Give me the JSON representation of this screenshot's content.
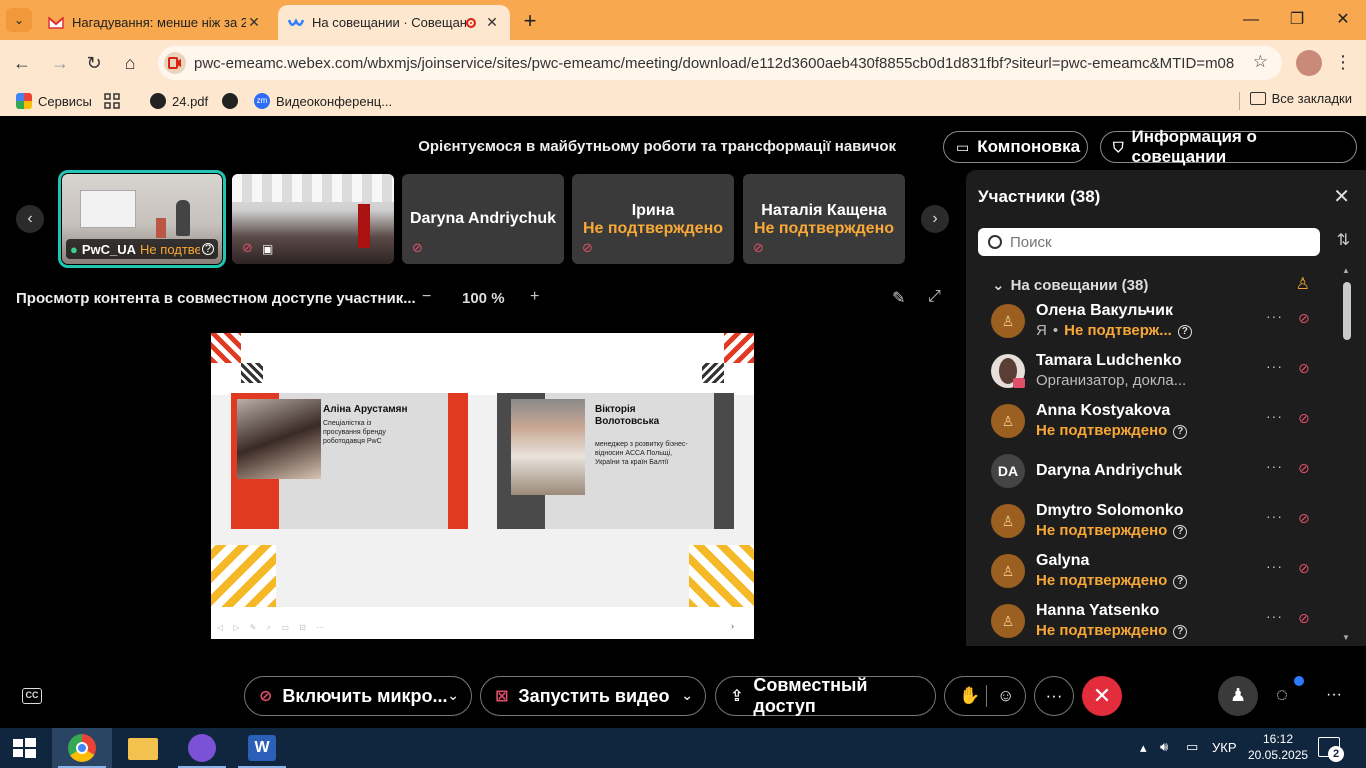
{
  "browser": {
    "tabs": [
      {
        "title": "Нагадування: менше ніж за 2 ...",
        "active": false
      },
      {
        "title": "На совещании · Совещани...",
        "active": true
      }
    ],
    "url": "pwc-emeamc.webex.com/wbxmjs/joinservice/sites/pwc-emeamc/meeting/download/e112d3600aeb430f8855cb0d1d831fbf?siteurl=pwc-emeamc&MTID=m08361b51c...",
    "bookmarks": [
      {
        "label": "Сервисы"
      },
      {
        "label": "24.pdf"
      },
      {
        "label": ""
      },
      {
        "label": "Видеоконференц..."
      }
    ],
    "all_bookmarks": "Все закладки"
  },
  "meeting": {
    "title": "Орієнтуємося в майбутньому роботи та трансформації навичок",
    "layout_button": "Компоновка",
    "info_button": "Информация о совещании",
    "content_label": "Просмотр контента в совместном доступе участник...",
    "zoom_level": "100 %",
    "tiles": [
      {
        "name": "PwC_UA",
        "status": "Не подтверждено"
      },
      {
        "name": "",
        "status": ""
      },
      {
        "name": "Daryna Andriychuk",
        "status": ""
      },
      {
        "name": "Ірина",
        "status": "Не подтверждено"
      },
      {
        "name": "Наталія Кащена",
        "status": "Не подтверждено"
      }
    ]
  },
  "slide": {
    "person1": {
      "name": "Аліна Арустамян",
      "role": "Спеціалістка із просування бренду роботодавця PwC"
    },
    "person2": {
      "name": "Вікторія Волотовська",
      "role": "менеджер з розвитку бізнес-відносин ACCA Польщі, України та країн Балтії"
    },
    "page": "›"
  },
  "participants": {
    "title": "Участники (38)",
    "search_placeholder": "Поиск",
    "group": "На совещании (38)",
    "list": [
      {
        "name": "Олена Вакульчик",
        "me": "Я",
        "status": "Не подтверж...",
        "avatar": "default"
      },
      {
        "name": "Tamara Ludchenko",
        "role": "Организатор, докла...",
        "avatar": "photo"
      },
      {
        "name": "Anna Kostyakova",
        "status": "Не подтверждено",
        "avatar": "default"
      },
      {
        "name": "Daryna Andriychuk",
        "avatar": "initials",
        "initials": "DA"
      },
      {
        "name": "Dmytro Solomonko",
        "status": "Не подтверждено",
        "avatar": "default"
      },
      {
        "name": "Galyna",
        "status": "Не подтверждено",
        "avatar": "default"
      },
      {
        "name": "Hanna Yatsenko",
        "status": "Не подтверждено",
        "avatar": "default"
      }
    ]
  },
  "controls": {
    "mic": "Включить микро...",
    "video": "Запустить видео",
    "share": "Совместный доступ",
    "cc": "CC"
  },
  "taskbar": {
    "lang": "УКР",
    "time": "16:12",
    "date": "20.05.2025",
    "notifications": "2"
  }
}
